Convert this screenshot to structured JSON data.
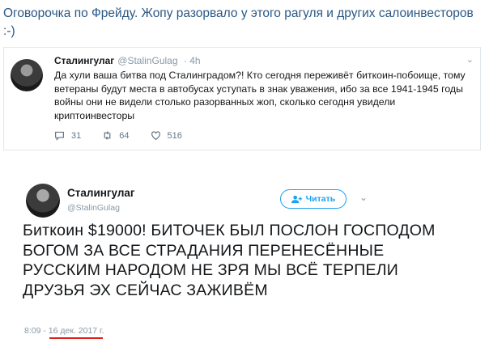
{
  "post": {
    "text": "Оговорочка по Фрейду. Жопу разорвало у этого рагуля и других салоинвесторов :-)"
  },
  "tweet1": {
    "name": "Сталингулаг",
    "handle": "@StalinGulag",
    "time": "· 4h",
    "text": "Да хули ваша битва под Сталинградом?! Кто сегодня переживёт биткоин-побоище, тому ветераны будут места в автобусах уступать в знак уважения, ибо за все 1941-1945 годы войны они не видели столько разорванных жоп, сколько сегодня увидели криптоинвесторы",
    "reply_count": "31",
    "retweet_count": "64",
    "like_count": "516",
    "icons": [
      "reply-icon",
      "retweet-icon",
      "like-icon",
      "chevron-down-icon"
    ]
  },
  "tweet2": {
    "name": "Сталингулаг",
    "handle": "@StalinGulag",
    "follow_label": "Читать",
    "text": "Биткоин $19000! БИТОЧЕК БЫЛ ПОСЛОН ГОСПОДОМ БОГОМ ЗА ВСЕ СТРАДАНИЯ ПЕРЕНЕСЁННЫЕ РУССКИМ НАРОДОМ НЕ ЗРЯ МЫ ВСЁ ТЕРПЕЛИ ДРУЗЬЯ ЭХ СЕЙЧАС ЗАЖИВЁМ",
    "time": "8:09 -",
    "date": "16 дек. 2017 г.",
    "icons": [
      "follow-user-icon",
      "chevron-down-icon"
    ]
  },
  "colors": {
    "link": "#2a5885",
    "twitter_blue": "#1da1f2",
    "muted": "#8899a6",
    "underline": "#e0201a"
  }
}
